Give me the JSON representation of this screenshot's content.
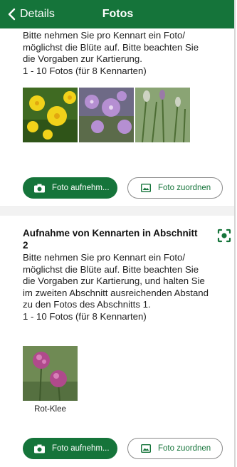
{
  "header": {
    "back_label": "Details",
    "title": "Fotos"
  },
  "section1": {
    "description": "Bitte nehmen Sie pro Kennart ein Foto/ möglichst die Blüte auf. Bitte beachten Sie die Vorgaben zur Kartierung.",
    "count": "1 - 10 Fotos (für 8 Kennarten)",
    "photos": [
      "yellow-flower-photo",
      "purple-flower-photo",
      "grass-plant-photo"
    ],
    "take_photo_label": "Foto aufnehm...",
    "assign_photo_label": "Foto zuordnen"
  },
  "section2": {
    "title": "Aufnahme von Kennarten in Abschnitt 2",
    "description": "Bitte nehmen Sie pro Kennart ein Foto/ möglichst die Blüte auf. Bitte beachten Sie die Vorgaben zur Kartierung, und halten Sie im zweiten Abschnitt ausreichenden Abstand zu den Fotos des Abschnitts 1.",
    "count": "1 - 10 Fotos (für 8 Kennarten)",
    "species_label": "Rot-Klee",
    "take_photo_label": "Foto aufnehm...",
    "assign_photo_label": "Foto zuordnen"
  },
  "colors": {
    "brand_green": "#15743a",
    "section_gap": "#f2f2f2"
  }
}
